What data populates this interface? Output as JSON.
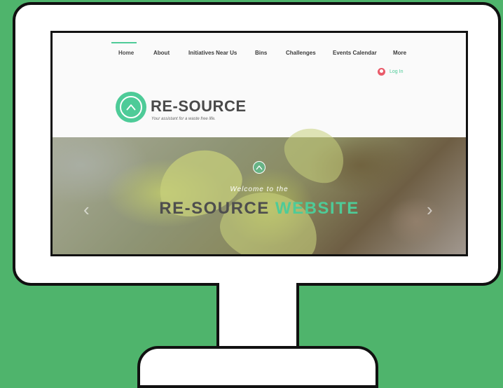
{
  "nav": {
    "items": [
      {
        "label": "Home"
      },
      {
        "label": "About"
      },
      {
        "label": "Initiatives Near Us"
      },
      {
        "label": "Bins"
      },
      {
        "label": "Challenges"
      },
      {
        "label": "Events Calendar"
      },
      {
        "label": "More"
      }
    ],
    "login_label": "Log In"
  },
  "brand": {
    "name": "RE-SOURCE",
    "tagline": "Your assistant for a waste free life."
  },
  "hero": {
    "welcome": "Welcome to the",
    "title_part1": "RE-SOURCE ",
    "title_part2": "WEBSITE",
    "prev_arrow": "‹",
    "next_arrow": "›"
  },
  "colors": {
    "background": "#4fb46c",
    "accent": "#4ecb98",
    "login_avatar": "#e95b6a",
    "text_dark": "#4a4a4a"
  },
  "icons": [
    "logo-mountain-icon",
    "user-avatar-icon",
    "chevron-left-icon",
    "chevron-right-icon"
  ]
}
